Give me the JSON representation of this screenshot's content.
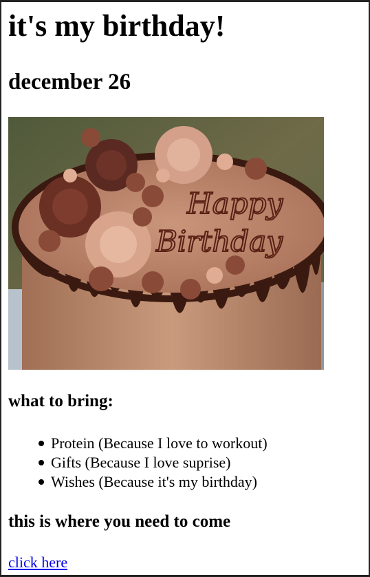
{
  "header": {
    "title": "it's my birthday!",
    "date": "december 26"
  },
  "image": {
    "cake_inscription_line1": "Happy",
    "cake_inscription_line2": "Birthday"
  },
  "bring": {
    "heading": "what to bring:",
    "items": [
      "Protein (Because I love to workout)",
      "Gifts (Because I love suprise)",
      "Wishes (Because it's my birthday)"
    ]
  },
  "location": {
    "heading": "this is where you need to come",
    "link_text": "click here"
  },
  "colors": {
    "link": "#0000ee",
    "border": "#222222"
  }
}
